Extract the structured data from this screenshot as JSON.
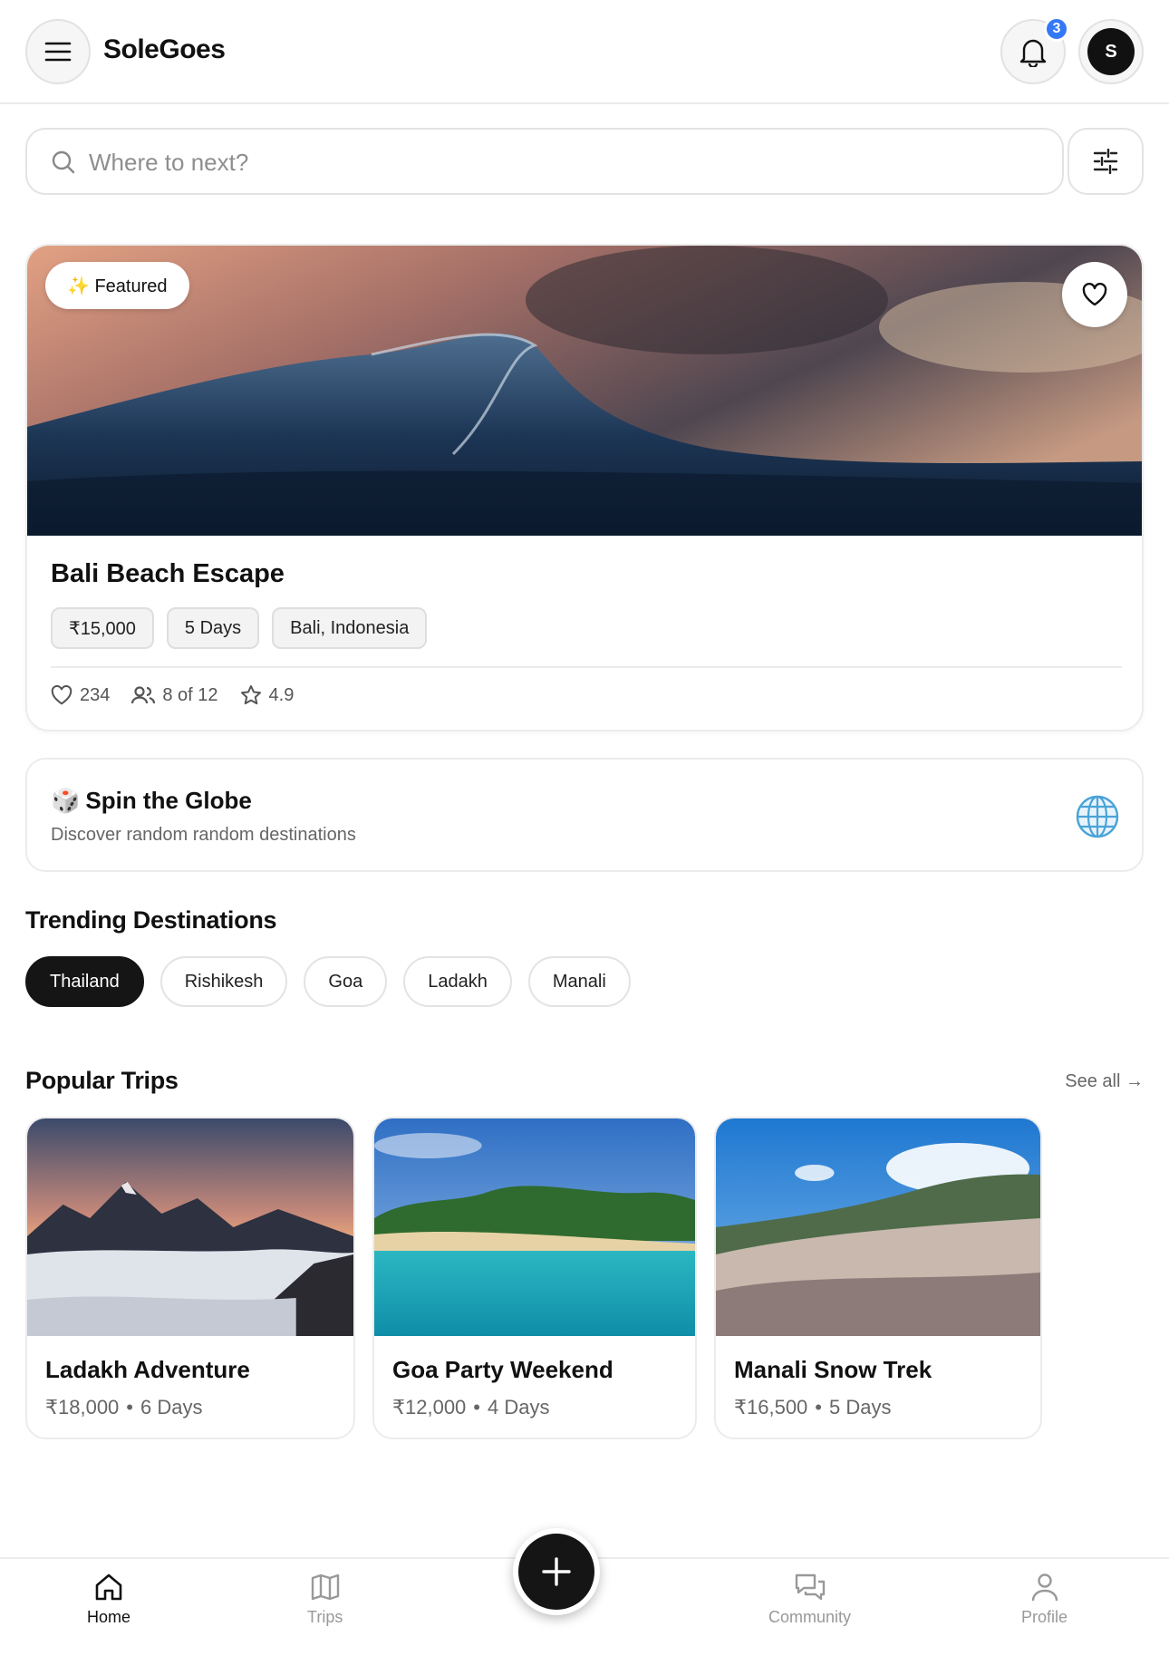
{
  "header": {
    "app_title": "SoleGoes",
    "notification_count": "3",
    "avatar_initial": "S"
  },
  "search": {
    "placeholder": "Where to next?"
  },
  "featured": {
    "badge_label": "✨ Featured",
    "title": "Bali Beach Escape",
    "price": "₹15,000",
    "duration": "5 Days",
    "location": "Bali, Indonesia",
    "likes": "234",
    "spots": "8 of 12",
    "rating": "4.9"
  },
  "spin": {
    "emoji": "🎲",
    "title": "Spin the Globe",
    "subtitle": "Discover random random destinations"
  },
  "trending": {
    "title": "Trending Destinations",
    "tags": [
      "Thailand",
      "Rishikesh",
      "Goa",
      "Ladakh",
      "Manali"
    ],
    "active_index": 0
  },
  "popular": {
    "title": "Popular Trips",
    "see_all": "See all →",
    "trips": [
      {
        "title": "Ladakh Adventure",
        "price": "₹18,000",
        "duration": "6 Days"
      },
      {
        "title": "Goa Party Weekend",
        "price": "₹12,000",
        "duration": "4 Days"
      },
      {
        "title": "Manali Snow Trek",
        "price": "₹16,500",
        "duration": "5 Days"
      }
    ]
  },
  "bottom_nav": {
    "items": [
      "Home",
      "Trips",
      "Community",
      "Profile"
    ],
    "active": "Home"
  },
  "colors": {
    "accent": "#151515",
    "badge": "#3478f6",
    "border": "#ececec"
  }
}
